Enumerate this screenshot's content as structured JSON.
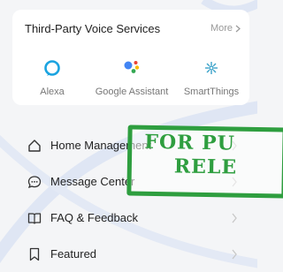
{
  "voice_services": {
    "title": "Third-Party Voice Services",
    "more_label": "More",
    "items": [
      {
        "label": "Alexa",
        "icon": "alexa-icon"
      },
      {
        "label": "Google Assistant",
        "icon": "google-assistant-icon"
      },
      {
        "label": "SmartThings",
        "icon": "smartthings-icon"
      }
    ]
  },
  "menu": {
    "items": [
      {
        "label": "Home Management",
        "icon": "home-icon"
      },
      {
        "label": "Message Center",
        "icon": "chat-bubble-icon"
      },
      {
        "label": "FAQ & Feedback",
        "icon": "book-icon"
      },
      {
        "label": "Featured",
        "icon": "bookmark-icon"
      }
    ]
  },
  "stamp": {
    "line1": "FOR PU",
    "line2": "RELE"
  },
  "colors": {
    "background": "#f4f5f7",
    "card": "#ffffff",
    "alexa": "#1aa3e0",
    "stamp": "#2e9e3f",
    "watermark": "#d7e0f3"
  }
}
